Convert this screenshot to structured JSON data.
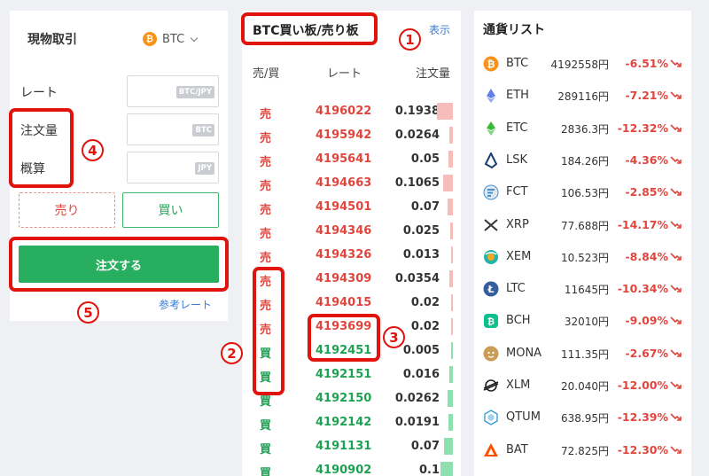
{
  "trade": {
    "title": "現物取引",
    "coin_icon": "₿",
    "coin": "BTC",
    "rate_label": "レート",
    "rate_unit": "BTC/JPY",
    "amount_label": "注文量",
    "amount_unit": "BTC",
    "estimate_label": "概算",
    "estimate_unit": "JPY",
    "sell_label": "売り",
    "buy_label": "買い",
    "order_label": "注文する",
    "reference_link": "参考レート"
  },
  "orderbook": {
    "title": "BTC買い板/売り板",
    "show_link": "表示",
    "headers": {
      "side": "売/買",
      "rate": "レート",
      "qty": "注文量"
    },
    "rows": [
      {
        "side": "売",
        "rate": "4196022",
        "qty": "0.1938",
        "type": "sell",
        "depth": 0.9
      },
      {
        "side": "売",
        "rate": "4195942",
        "qty": "0.0264",
        "type": "sell",
        "depth": 0.2
      },
      {
        "side": "売",
        "rate": "4195641",
        "qty": "0.05",
        "type": "sell",
        "depth": 0.25
      },
      {
        "side": "売",
        "rate": "4194663",
        "qty": "0.1065",
        "type": "sell",
        "depth": 0.55
      },
      {
        "side": "売",
        "rate": "4194501",
        "qty": "0.07",
        "type": "sell",
        "depth": 0.3
      },
      {
        "side": "売",
        "rate": "4194346",
        "qty": "0.025",
        "type": "sell",
        "depth": 0.15
      },
      {
        "side": "売",
        "rate": "4194326",
        "qty": "0.013",
        "type": "sell",
        "depth": 0.1
      },
      {
        "side": "売",
        "rate": "4194309",
        "qty": "0.0354",
        "type": "sell",
        "depth": 0.2
      },
      {
        "side": "売",
        "rate": "4194015",
        "qty": "0.02",
        "type": "sell",
        "depth": 0.12
      },
      {
        "side": "売",
        "rate": "4193699",
        "qty": "0.02",
        "type": "sell",
        "depth": 0.12
      },
      {
        "side": "買",
        "rate": "4192451",
        "qty": "0.005",
        "type": "buy",
        "depth": 0.08
      },
      {
        "side": "買",
        "rate": "4192151",
        "qty": "0.016",
        "type": "buy",
        "depth": 0.2
      },
      {
        "side": "買",
        "rate": "4192150",
        "qty": "0.0262",
        "type": "buy",
        "depth": 0.3
      },
      {
        "side": "買",
        "rate": "4192142",
        "qty": "0.0191",
        "type": "buy",
        "depth": 0.25
      },
      {
        "side": "買",
        "rate": "4191131",
        "qty": "0.07",
        "type": "buy",
        "depth": 0.5
      },
      {
        "side": "買",
        "rate": "4190902",
        "qty": "0.1",
        "type": "buy",
        "depth": 0.7
      }
    ]
  },
  "currency_list": {
    "title": "通貨リスト",
    "items": [
      {
        "symbol": "BTC",
        "price": "4192558円",
        "change": "-6.51%",
        "icon": "bitcoin-icon",
        "color": "#f7931a"
      },
      {
        "symbol": "ETH",
        "price": "289116円",
        "change": "-7.21%",
        "icon": "ethereum-icon",
        "color": "#627eea"
      },
      {
        "symbol": "ETC",
        "price": "2836.3円",
        "change": "-12.32%",
        "icon": "ethereum-classic-icon",
        "color": "#3ab83a"
      },
      {
        "symbol": "LSK",
        "price": "184.26円",
        "change": "-4.36%",
        "icon": "lisk-icon",
        "color": "#1a3d6e"
      },
      {
        "symbol": "FCT",
        "price": "106.53円",
        "change": "-2.85%",
        "icon": "factom-icon",
        "color": "#4a90c8"
      },
      {
        "symbol": "XRP",
        "price": "77.688円",
        "change": "-14.17%",
        "icon": "ripple-icon",
        "color": "#333333"
      },
      {
        "symbol": "XEM",
        "price": "10.523円",
        "change": "-8.84%",
        "icon": "nem-icon",
        "color": "#22b4a8"
      },
      {
        "symbol": "LTC",
        "price": "11645円",
        "change": "-10.34%",
        "icon": "litecoin-icon",
        "color": "#345d9d"
      },
      {
        "symbol": "BCH",
        "price": "32010円",
        "change": "-9.09%",
        "icon": "bitcoin-cash-icon",
        "color": "#0ac18e"
      },
      {
        "symbol": "MONA",
        "price": "111.35円",
        "change": "-2.67%",
        "icon": "monacoin-icon",
        "color": "#c99d55"
      },
      {
        "symbol": "XLM",
        "price": "20.040円",
        "change": "-12.00%",
        "icon": "stellar-icon",
        "color": "#222222"
      },
      {
        "symbol": "QTUM",
        "price": "638.95円",
        "change": "-12.39%",
        "icon": "qtum-icon",
        "color": "#2e9ad0"
      },
      {
        "symbol": "BAT",
        "price": "72.825円",
        "change": "-12.30%",
        "icon": "bat-icon",
        "color": "#ff5000"
      }
    ]
  },
  "annotations": [
    "1",
    "2",
    "3",
    "4",
    "5"
  ],
  "colors": {
    "sell": "#e0463e",
    "buy": "#1fa154",
    "order_button": "#27ae5f",
    "annotation": "#e0130d",
    "link": "#3a7bd5"
  }
}
